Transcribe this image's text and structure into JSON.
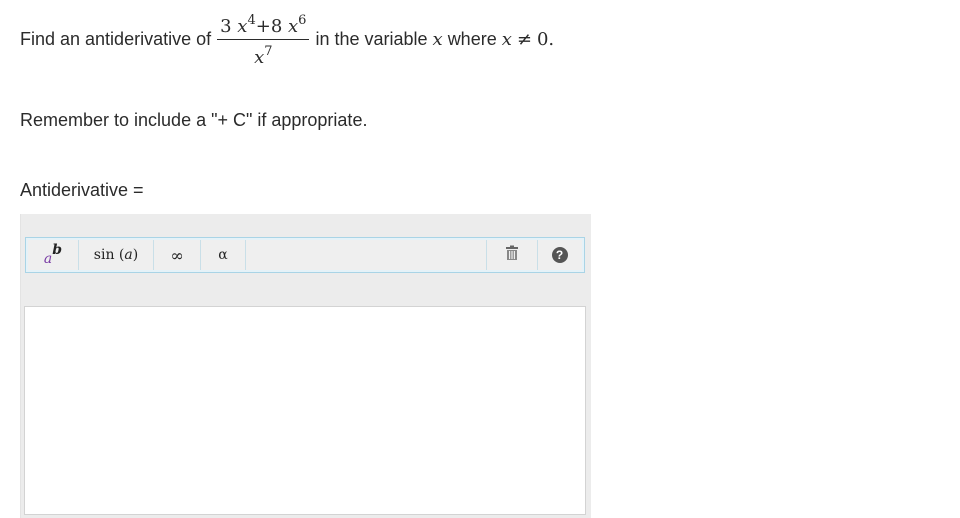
{
  "prompt": {
    "prefix": "Find an antiderivative of",
    "numerator": {
      "coef1": "3",
      "var1": "x",
      "exp1": "4",
      "op": "+8",
      "var2": "x",
      "exp2": "6"
    },
    "denominator": {
      "var": "x",
      "exp": "7"
    },
    "suffix_text": "in the variable",
    "variable": "x",
    "where_text": "where",
    "condition_var": "x",
    "condition_rel": "≠",
    "condition_val": "0.",
    "remember": "Remember to include a \"+ C\" if appropriate."
  },
  "answer": {
    "label": "Antiderivative =",
    "value": ""
  },
  "toolbar": {
    "power_base": "a",
    "power_exp": "b",
    "sin_fn": "sin",
    "sin_open": "(",
    "sin_arg": "a",
    "sin_close": ")",
    "infinity": "∞",
    "alpha": "α",
    "help": "?"
  },
  "colors": {
    "accent_purple": "#7b3fa6",
    "toolbar_border": "#a9d4e6",
    "editor_bg": "#ececec"
  },
  "icons": [
    "trash-icon",
    "help-icon"
  ]
}
